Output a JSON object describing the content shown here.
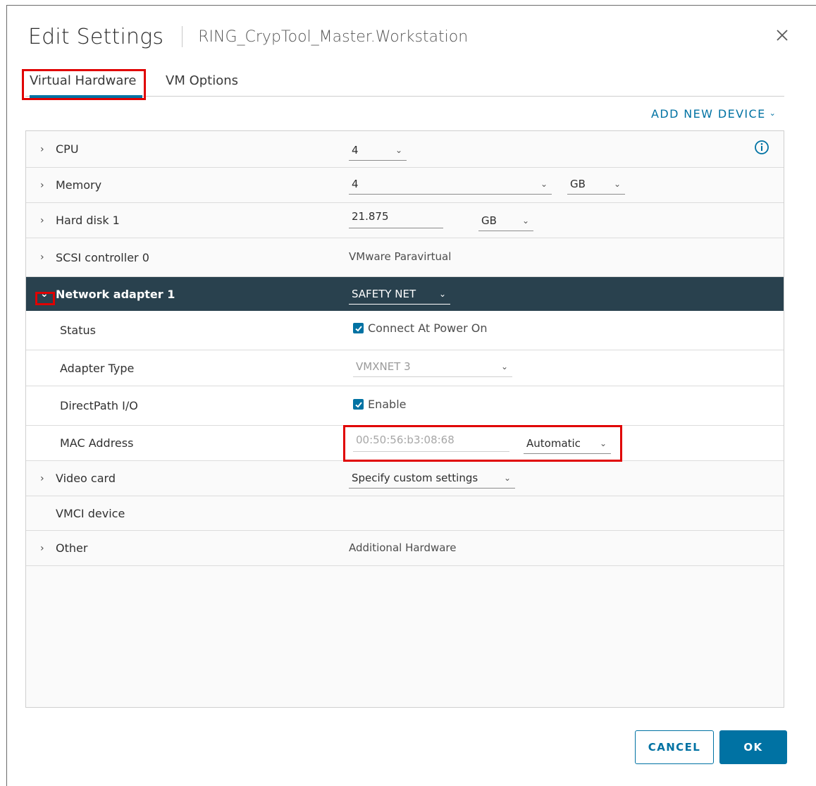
{
  "dialog": {
    "title": "Edit Settings",
    "subtitle": "RING_CrypTool_Master.Workstation",
    "close_icon": "close-icon"
  },
  "tabs": [
    {
      "label": "Virtual Hardware",
      "active": true
    },
    {
      "label": "VM Options",
      "active": false
    }
  ],
  "add_device": {
    "label": "ADD NEW DEVICE",
    "icon": "chevron-down-icon"
  },
  "hardware": {
    "cpu": {
      "label": "CPU",
      "value": "4"
    },
    "memory": {
      "label": "Memory",
      "value": "4",
      "unit": "GB"
    },
    "hard_disk": {
      "label": "Hard disk 1",
      "value": "21.875",
      "unit": "GB"
    },
    "scsi": {
      "label": "SCSI controller 0",
      "value": "VMware Paravirtual"
    },
    "network": {
      "label": "Network adapter 1",
      "value": "SAFETY NET",
      "status": {
        "label": "Status",
        "checkbox_label": "Connect At Power On",
        "checked": true
      },
      "adapter_type": {
        "label": "Adapter Type",
        "value": "VMXNET 3"
      },
      "directpath": {
        "label": "DirectPath I/O",
        "checkbox_label": "Enable",
        "checked": true
      },
      "mac": {
        "label": "MAC Address",
        "value": "00:50:56:b3:08:68",
        "mode": "Automatic"
      }
    },
    "video": {
      "label": "Video card",
      "value": "Specify custom settings"
    },
    "vmci": {
      "label": "VMCI device"
    },
    "other": {
      "label": "Other",
      "value": "Additional Hardware"
    }
  },
  "buttons": {
    "cancel": "CANCEL",
    "ok": "OK"
  },
  "colors": {
    "accent": "#0072a3",
    "selected_row": "#29414e",
    "highlight": "#e00000"
  }
}
